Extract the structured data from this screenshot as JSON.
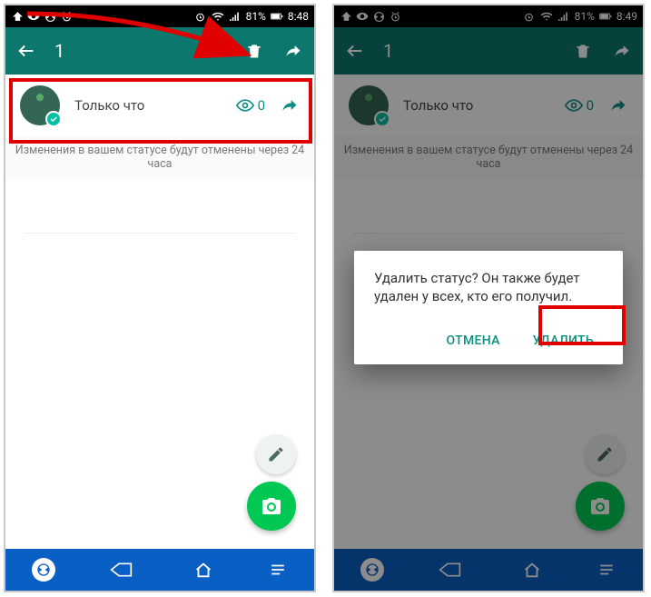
{
  "statusbar": {
    "battery": "81%",
    "time_left": "8:48",
    "time_right": "8:49"
  },
  "appbar": {
    "count": "1"
  },
  "status_item": {
    "label": "Только что",
    "views": "0"
  },
  "info": "Изменения в вашем статусе будут отменены через 24 часа",
  "dialog": {
    "message": "Удалить статус? Он также будет удален у всех, кто его получил.",
    "cancel": "ОТМЕНА",
    "delete": "УДАЛИТЬ"
  }
}
